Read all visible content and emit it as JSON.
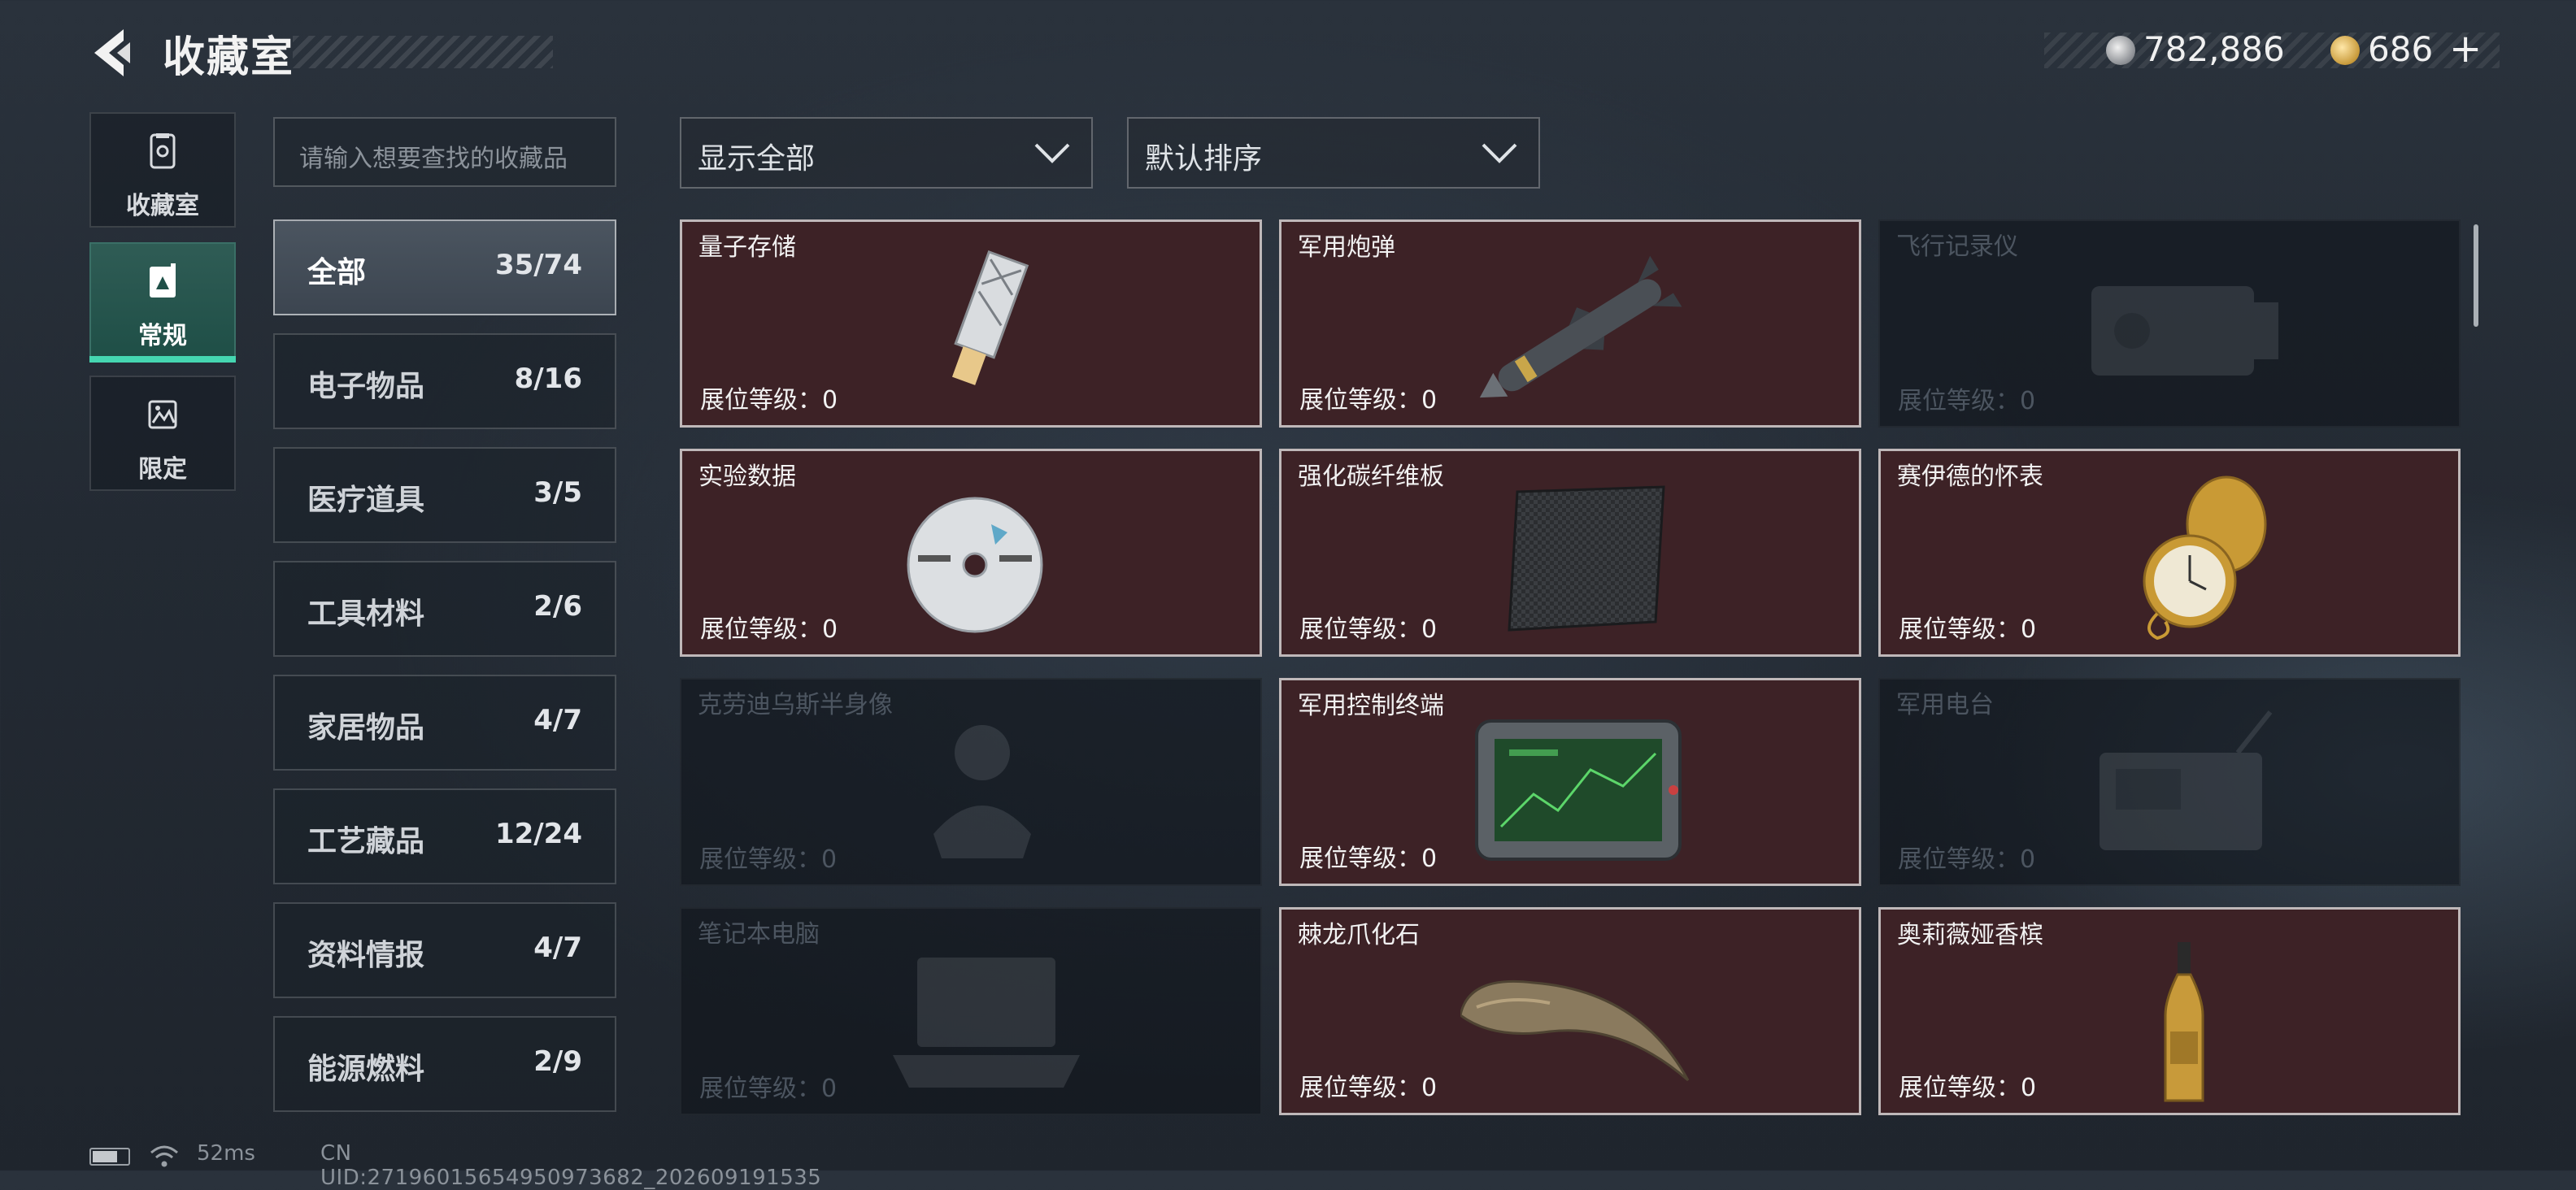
{
  "header": {
    "title": "收藏室",
    "currency": [
      {
        "icon": "silver-coin-icon",
        "value": "782,886"
      },
      {
        "icon": "gold-coin-icon",
        "value": "686"
      }
    ],
    "add_label": "+"
  },
  "side_tabs": [
    {
      "label": "收藏室",
      "icon": "collection-room-icon",
      "active": false
    },
    {
      "label": "常规",
      "icon": "regular-icon",
      "active": true
    },
    {
      "label": "限定",
      "icon": "limited-icon",
      "active": false
    }
  ],
  "search": {
    "placeholder": "请输入想要查找的收藏品"
  },
  "categories": [
    {
      "name": "全部",
      "count": "35/74",
      "selected": true
    },
    {
      "name": "电子物品",
      "count": "8/16",
      "selected": false
    },
    {
      "name": "医疗道具",
      "count": "3/5",
      "selected": false
    },
    {
      "name": "工具材料",
      "count": "2/6",
      "selected": false
    },
    {
      "name": "家居物品",
      "count": "4/7",
      "selected": false
    },
    {
      "name": "工艺藏品",
      "count": "12/24",
      "selected": false
    },
    {
      "name": "资料情报",
      "count": "4/7",
      "selected": false
    },
    {
      "name": "能源燃料",
      "count": "2/9",
      "selected": false
    }
  ],
  "filters": {
    "show": "显示全部",
    "sort": "默认排序"
  },
  "items": [
    {
      "name": "量子存储",
      "level": "展位等级：0",
      "owned": true,
      "icon": "usb-drive-icon"
    },
    {
      "name": "军用炮弹",
      "level": "展位等级：0",
      "owned": true,
      "icon": "missile-icon"
    },
    {
      "name": "飞行记录仪",
      "level": "展位等级：0",
      "owned": false,
      "icon": "flight-recorder-icon"
    },
    {
      "name": "实验数据",
      "level": "展位等级：0",
      "owned": true,
      "icon": "disc-icon"
    },
    {
      "name": "强化碳纤维板",
      "level": "展位等级：0",
      "owned": true,
      "icon": "carbon-plate-icon"
    },
    {
      "name": "赛伊德的怀表",
      "level": "展位等级：0",
      "owned": true,
      "icon": "pocket-watch-icon"
    },
    {
      "name": "克劳迪乌斯半身像",
      "level": "展位等级：0",
      "owned": false,
      "icon": "bust-statue-icon"
    },
    {
      "name": "军用控制终端",
      "level": "展位等级：0",
      "owned": true,
      "icon": "control-terminal-icon"
    },
    {
      "name": "军用电台",
      "level": "展位等级：0",
      "owned": false,
      "icon": "radio-icon"
    },
    {
      "name": "笔记本电脑",
      "level": "展位等级：0",
      "owned": false,
      "icon": "laptop-icon"
    },
    {
      "name": "棘龙爪化石",
      "level": "展位等级：0",
      "owned": true,
      "icon": "claw-fossil-icon"
    },
    {
      "name": "奥莉薇娅香槟",
      "level": "展位等级：0",
      "owned": true,
      "icon": "champagne-icon"
    }
  ],
  "footer": {
    "ping": "52ms",
    "uid": "CN UID:27196015654950973682_202609191535"
  },
  "colors": {
    "accent": "#45d6b1",
    "owned_card": "#3d2226",
    "locked_card": "#151b22"
  }
}
